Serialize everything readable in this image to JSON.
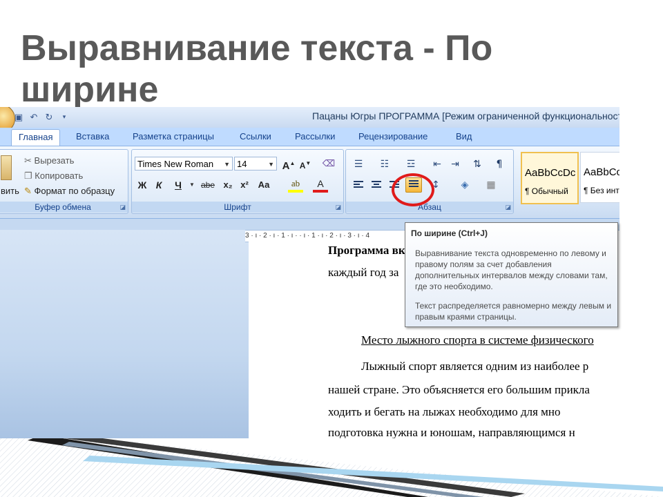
{
  "slide": {
    "title_line1": "Выравнивание текста - По",
    "title_line2": "ширине"
  },
  "window": {
    "title": "Пацаны Югры ПРОГРАММА [Режим ограниченной функциональности]"
  },
  "tabs": [
    "Главная",
    "Вставка",
    "Разметка страницы",
    "Ссылки",
    "Рассылки",
    "Рецензирование",
    "Вид"
  ],
  "clipboard": {
    "paste_label": "вить",
    "cut": "Вырезать",
    "copy": "Копировать",
    "format_painter": "Формат по образцу",
    "group_label": "Буфер обмена"
  },
  "font": {
    "font_name": "Times New Roman",
    "font_size": "14",
    "bold": "Ж",
    "italic": "К",
    "underline": "Ч",
    "strikethrough": "abe",
    "subscript": "x₂",
    "superscript": "x²",
    "change_case": "Аа",
    "grow": "A",
    "shrink": "A",
    "group_label": "Шрифт"
  },
  "paragraph": {
    "group_label": "Абзац"
  },
  "styles": [
    {
      "preview": "AaBbCcDc",
      "name": "¶ Обычный"
    },
    {
      "preview": "AaBbCc",
      "name": "¶ Без инте"
    }
  ],
  "ruler": {
    "ticks": "3 · ı · 2 · ı · 1 · ı ·   · ı · 1 · ı · 2 · ı · 3 · ı · 4"
  },
  "document": {
    "line1": "Программа вк",
    "line2": "каждый год за",
    "heading": "Место лыжного спорта в системе физического",
    "para1": "Лыжный спорт является одним из наиболее р",
    "para2": "нашей стране. Это объясняется его большим прикла",
    "para3": "ходить и бегать на лыжах необходимо для мно",
    "para4": "подготовка нужна и юношам, направляющимся н"
  },
  "tooltip": {
    "title": "По ширине (Ctrl+J)",
    "body1": "Выравнивание текста одновременно по левому и правому полям за счет добавления дополнительных интервалов между словами там, где это необходимо.",
    "body2": "Текст распределяется равномерно между левым и правым краями страницы."
  },
  "colors": {
    "highlight_button": "#f5b639",
    "annotation_circle": "#e01b1b",
    "title_text": "#595959",
    "ribbon_text": "#15428b"
  }
}
